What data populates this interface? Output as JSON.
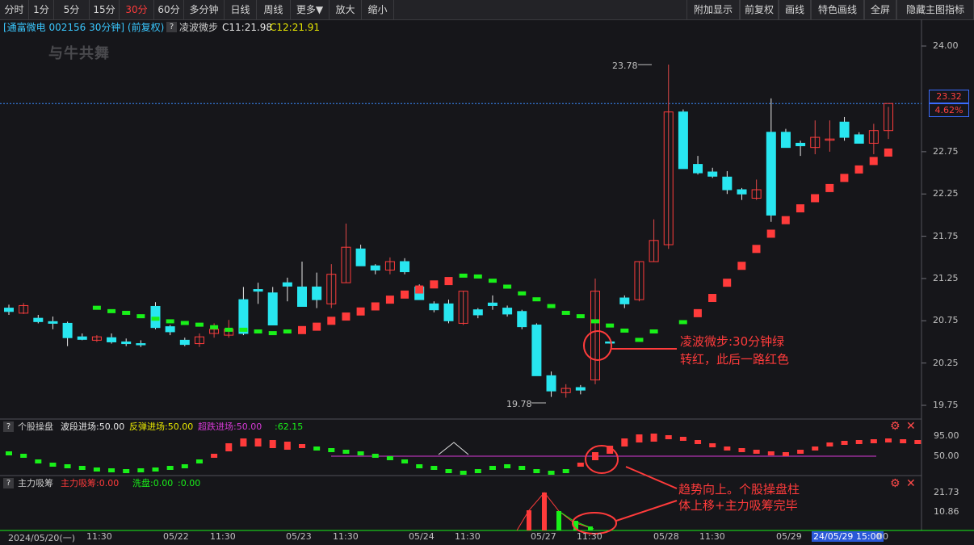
{
  "toolbar": {
    "periods": [
      "分时",
      "1分",
      "5分",
      "15分",
      "30分",
      "60分",
      "多分钟",
      "日线",
      "周线",
      "更多▼",
      "放大",
      "缩小"
    ],
    "active_period": "30分",
    "right": [
      "附加显示",
      "前复权",
      "画线",
      "特色画线",
      "全屏",
      "隐藏主图指标"
    ]
  },
  "main": {
    "header_stock": "[通富微电 002156 30分钟] (前复权)",
    "indicator_name": "凌波微步",
    "c1": "C11:21.98",
    "c2": "C12:21.91",
    "price_axis": [
      "24.00",
      "23.25",
      "22.75",
      "22.25",
      "21.75",
      "21.25",
      "20.75",
      "20.25",
      "19.75"
    ],
    "current_price": "23.32",
    "current_pct": "4.62%",
    "high_label": "23.78",
    "low_label": "19.78",
    "annotation": [
      "凌波微步:30分钟绿",
      "转红，此后一路红色"
    ],
    "watermark": "与牛共舞"
  },
  "panel1": {
    "name": "个股操盘",
    "wave_label": "波段进场:50.00",
    "rebound_label": "反弹进场:50.00",
    "oversold_label": "超跌进场:50.00",
    "val_label": ":62.15",
    "axis": [
      "95.00",
      "50.00"
    ]
  },
  "panel2": {
    "name": "主力吸筹",
    "absorb_label": "主力吸筹:0.00",
    "wash_label": "洗盘:0.00",
    "zero_label": ":0.00",
    "axis": [
      "21.73",
      "10.86"
    ],
    "annotation": [
      "趋势向上。个股操盘柱",
      "体上移+主力吸筹完毕"
    ]
  },
  "time_axis": [
    "2024/05/20(一)",
    "11:30",
    "05/22",
    "11:30",
    "05/23",
    "11:30",
    "05/24",
    "11:30",
    "05/27",
    "11:30",
    "05/28",
    "11:30",
    "05/29",
    "24/05/29 15:00",
    "00"
  ],
  "colors": {
    "up": "#ff3b3b",
    "down": "#28e6f0",
    "green": "#19f019",
    "magenta": "#d63ad6",
    "yellow": "#e8e800"
  },
  "chart_data": {
    "type": "candlestick",
    "title": "通富微电 002156 30分钟 (前复权)",
    "x": [
      "05/20 10:00",
      "05/20 10:30",
      "05/20 11:00",
      "05/20 11:30",
      "05/20 13:30",
      "05/20 14:00",
      "05/20 14:30",
      "05/20 15:00",
      "05/21 10:00",
      "05/21 10:30",
      "05/21 11:00",
      "05/21 11:30",
      "05/21 13:30",
      "05/21 14:00",
      "05/21 14:30",
      "05/21 15:00",
      "05/22 10:00",
      "05/22 10:30",
      "05/22 11:00",
      "05/22 11:30",
      "05/22 13:30",
      "05/22 14:00",
      "05/22 14:30",
      "05/22 15:00",
      "05/23 10:00",
      "05/23 10:30",
      "05/23 11:00",
      "05/23 11:30",
      "05/23 13:30",
      "05/23 14:00",
      "05/23 14:30",
      "05/23 15:00",
      "05/24 10:00",
      "05/24 10:30",
      "05/24 11:00",
      "05/24 11:30",
      "05/24 13:30",
      "05/24 14:00",
      "05/24 14:30",
      "05/24 15:00",
      "05/27 10:00",
      "05/27 10:30",
      "05/27 11:00",
      "05/27 11:30",
      "05/27 13:30",
      "05/27 14:00",
      "05/27 14:30",
      "05/27 15:00",
      "05/28 10:00",
      "05/28 10:30",
      "05/28 11:00",
      "05/28 11:30",
      "05/28 13:30",
      "05/28 14:00",
      "05/28 14:30",
      "05/28 15:00",
      "05/29 10:00",
      "05/29 10:30",
      "05/29 11:00",
      "05/29 11:30",
      "05/29 13:30",
      "05/29 14:00",
      "05/29 14:30",
      "05/29 15:00"
    ],
    "ohlc": [
      [
        20.9,
        20.94,
        20.82,
        20.86
      ],
      [
        20.84,
        20.96,
        20.83,
        20.93
      ],
      [
        20.78,
        20.82,
        20.72,
        20.74
      ],
      [
        20.74,
        20.8,
        20.65,
        20.72
      ],
      [
        20.72,
        20.74,
        20.45,
        20.55
      ],
      [
        20.56,
        20.6,
        20.52,
        20.53
      ],
      [
        20.52,
        20.58,
        20.5,
        20.56
      ],
      [
        20.55,
        20.6,
        20.48,
        20.5
      ],
      [
        20.5,
        20.54,
        20.45,
        20.48
      ],
      [
        20.48,
        20.52,
        20.44,
        20.47
      ],
      [
        20.92,
        20.97,
        20.65,
        20.67
      ],
      [
        20.68,
        20.7,
        20.58,
        20.62
      ],
      [
        20.52,
        20.55,
        20.45,
        20.47
      ],
      [
        20.48,
        20.6,
        20.44,
        20.56
      ],
      [
        20.6,
        20.72,
        20.55,
        20.65
      ],
      [
        20.58,
        20.76,
        20.55,
        20.65
      ],
      [
        21.0,
        21.15,
        20.58,
        20.6
      ],
      [
        21.12,
        21.2,
        20.95,
        21.1
      ],
      [
        21.08,
        21.15,
        20.7,
        20.7
      ],
      [
        21.2,
        21.26,
        20.98,
        21.16
      ],
      [
        21.15,
        21.45,
        20.92,
        20.92
      ],
      [
        21.15,
        21.32,
        20.9,
        21.0
      ],
      [
        20.95,
        21.42,
        20.9,
        21.3
      ],
      [
        21.2,
        21.9,
        21.2,
        21.62
      ],
      [
        21.6,
        21.65,
        21.4,
        21.4
      ],
      [
        21.4,
        21.42,
        21.3,
        21.35
      ],
      [
        21.35,
        21.5,
        21.3,
        21.45
      ],
      [
        21.45,
        21.49,
        21.3,
        21.33
      ],
      [
        21.15,
        21.18,
        21.0,
        21.0
      ],
      [
        20.95,
        20.98,
        20.85,
        20.88
      ],
      [
        20.95,
        21.0,
        20.72,
        20.75
      ],
      [
        20.72,
        21.1,
        20.7,
        21.1
      ],
      [
        20.88,
        20.9,
        20.78,
        20.82
      ],
      [
        20.96,
        21.05,
        20.88,
        20.93
      ],
      [
        20.9,
        20.93,
        20.8,
        20.83
      ],
      [
        20.86,
        20.88,
        20.65,
        20.68
      ],
      [
        20.7,
        20.72,
        20.15,
        20.1
      ],
      [
        20.1,
        20.15,
        19.85,
        19.92
      ],
      [
        19.9,
        20.0,
        19.84,
        19.95
      ],
      [
        19.96,
        19.99,
        19.88,
        19.93
      ],
      [
        20.05,
        21.25,
        20.0,
        21.1
      ],
      [
        20.5,
        20.5,
        20.48,
        20.49
      ],
      [
        21.02,
        21.05,
        20.9,
        20.95
      ],
      [
        21.0,
        21.45,
        20.98,
        21.45
      ],
      [
        21.45,
        21.95,
        21.45,
        21.7
      ],
      [
        21.65,
        23.78,
        21.6,
        23.22
      ],
      [
        23.22,
        23.25,
        22.6,
        22.55
      ],
      [
        22.6,
        22.7,
        22.48,
        22.5
      ],
      [
        22.51,
        22.56,
        22.44,
        22.46
      ],
      [
        22.45,
        22.52,
        22.25,
        22.3
      ],
      [
        22.3,
        22.32,
        22.18,
        22.25
      ],
      [
        22.2,
        22.42,
        22.18,
        22.3
      ],
      [
        22.98,
        23.38,
        21.92,
        22.0
      ],
      [
        22.98,
        23.02,
        22.8,
        22.8
      ],
      [
        22.85,
        22.88,
        22.7,
        22.82
      ],
      [
        22.8,
        23.12,
        22.72,
        22.92
      ],
      [
        22.9,
        23.12,
        22.75,
        22.9
      ],
      [
        23.1,
        23.16,
        22.88,
        22.92
      ],
      [
        22.95,
        22.98,
        22.85,
        22.85
      ],
      [
        22.85,
        23.08,
        22.72,
        23.0
      ],
      [
        23.0,
        23.28,
        22.9,
        23.32
      ]
    ],
    "lingbo_line": [
      20.88,
      20.84,
      20.82,
      20.78,
      20.75,
      20.72,
      20.7,
      20.68,
      20.65,
      20.62,
      20.62,
      20.6,
      20.58,
      20.6,
      20.64,
      20.68,
      20.75,
      20.8,
      20.86,
      20.92,
      21.0,
      21.06,
      21.12,
      21.18,
      21.22,
      21.26,
      21.25,
      21.2,
      21.13,
      21.05,
      20.98,
      20.9,
      20.82,
      20.78,
      20.72,
      20.67,
      20.61,
      20.5,
      20.6,
      20.71,
      20.84,
      21.02,
      21.2,
      21.4,
      21.6,
      21.78,
      21.94,
      22.08,
      22.2,
      22.32,
      22.44,
      22.54,
      22.64,
      22.74
    ]
  }
}
